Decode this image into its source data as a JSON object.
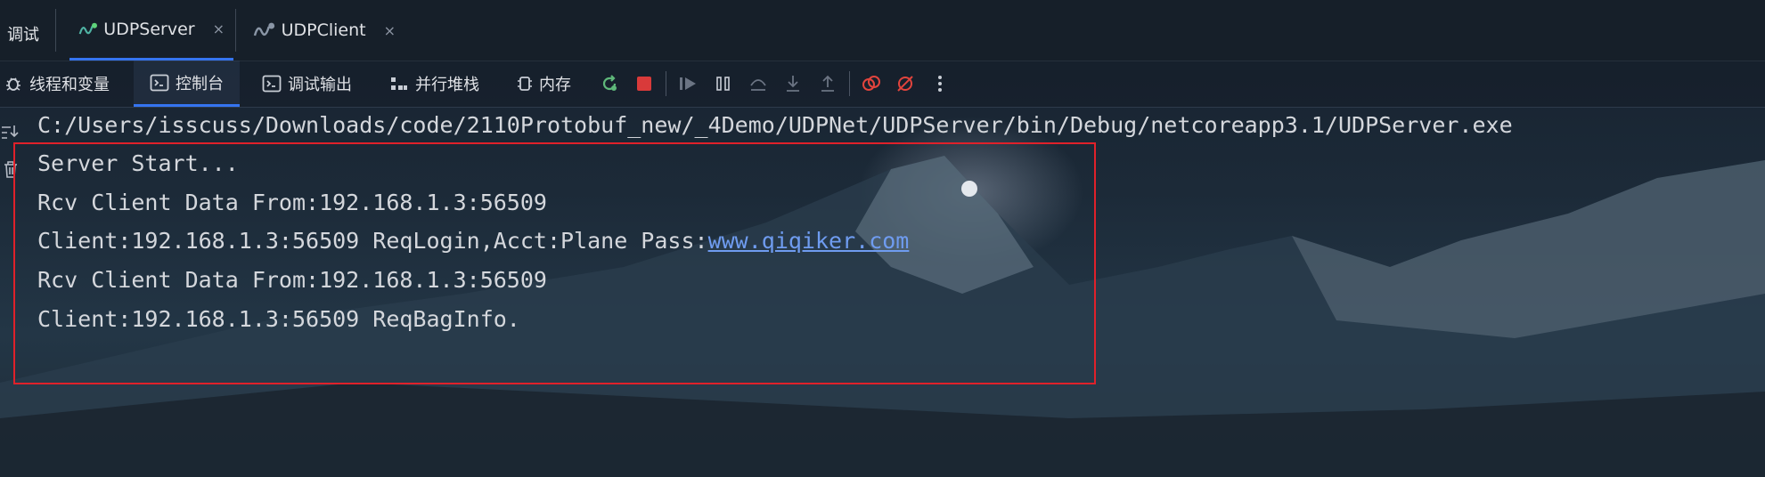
{
  "tabbar": {
    "debug_label": "调试",
    "tabs": [
      {
        "label": "UDPServer",
        "active": true
      },
      {
        "label": "UDPClient",
        "active": false
      }
    ],
    "close_glyph": "×"
  },
  "toolbar": {
    "items": [
      {
        "label": "线程和变量",
        "icon": "bug-icon"
      },
      {
        "label": "控制台",
        "icon": "console-icon",
        "active": true
      },
      {
        "label": "调试输出",
        "icon": "console-icon"
      },
      {
        "label": "并行堆栈",
        "icon": "stacks-icon"
      },
      {
        "label": "内存",
        "icon": "memory-icon"
      }
    ],
    "action_icons": [
      "rerun-icon",
      "stop-icon",
      "resume-icon",
      "pause-icon",
      "step-over-icon",
      "step-into-icon",
      "step-out-icon",
      "view-breakpoints-icon",
      "mute-breakpoints-icon",
      "more-icon"
    ]
  },
  "console": {
    "path_line": "C:/Users/isscuss/Downloads/code/2110Protobuf_new/_4Demo/UDPNet/UDPServer/bin/Debug/netcoreapp3.1/UDPServer.exe",
    "lines": [
      "Server Start...",
      "Rcv Client Data From:192.168.1.3:56509",
      "Client:192.168.1.3:56509 ReqLogin,Acct:Plane Pass:",
      "Rcv Client Data From:192.168.1.3:56509",
      "Client:192.168.1.3:56509 ReqBagInfo."
    ],
    "link_text": "www.qiqiker.com"
  },
  "colors": {
    "accent": "#3574f0",
    "highlight": "#e0212a",
    "stop": "#d93a3a",
    "link": "#6f9cf0"
  }
}
